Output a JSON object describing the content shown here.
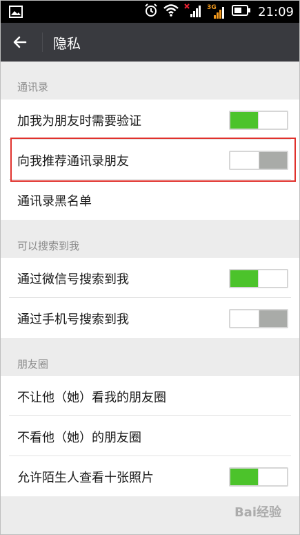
{
  "status_bar": {
    "time": "21:09",
    "network_label": "3G",
    "icons": [
      "image-icon",
      "alarm-icon",
      "wifi-icon",
      "signal-icon",
      "signal-3g-icon",
      "battery-icon"
    ]
  },
  "app_bar": {
    "back_icon": "arrow-left-icon",
    "title": "隐私"
  },
  "sections": {
    "contacts": {
      "header": "通讯录",
      "items": [
        {
          "label": "加我为朋友时需要验证",
          "toggle": "on"
        },
        {
          "label": "向我推荐通讯录朋友",
          "toggle": "off"
        },
        {
          "label": "通讯录黑名单"
        }
      ]
    },
    "search": {
      "header": "可以搜索到我",
      "items": [
        {
          "label": "通过微信号搜索到我",
          "toggle": "on"
        },
        {
          "label": "通过手机号搜索到我",
          "toggle": "off"
        }
      ]
    },
    "moments": {
      "header": "朋友圈",
      "items": [
        {
          "label": "不让他（她）看我的朋友圈"
        },
        {
          "label": "不看他（她）的朋友圈"
        },
        {
          "label": "允许陌生人查看十张照片",
          "toggle": "on"
        }
      ]
    }
  },
  "colors": {
    "toggle_on": "#4cc32b",
    "toggle_off": "#a9aba8",
    "app_bar": "#393a3f",
    "highlight": "#e0312c"
  },
  "watermark": "Bai经验"
}
